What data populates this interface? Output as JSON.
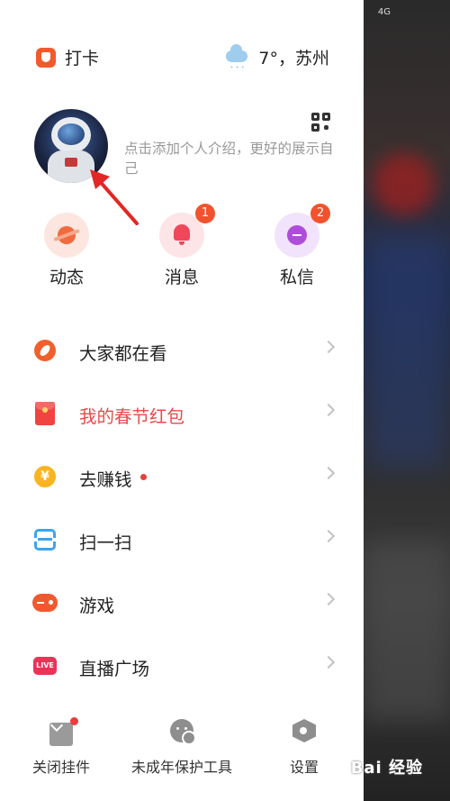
{
  "status_bar": {
    "signal_text": "4G"
  },
  "topbar": {
    "checkin_label": "打卡",
    "weather_label": "7°，苏州"
  },
  "profile": {
    "intro_placeholder": "点击添加个人介绍，更好的展示自己"
  },
  "quick_actions": [
    {
      "label": "动态",
      "icon": "planet-icon",
      "badge": ""
    },
    {
      "label": "消息",
      "icon": "bell-icon",
      "badge": "1"
    },
    {
      "label": "私信",
      "icon": "chat-bubble-icon",
      "badge": "2"
    }
  ],
  "menu": [
    {
      "label": "大家都在看",
      "icon": "compass-icon"
    },
    {
      "label": "我的春节红包",
      "icon": "red-packet-icon"
    },
    {
      "label": "去赚钱",
      "icon": "coin-icon",
      "coin_symbol": "¥"
    },
    {
      "label": "扫一扫",
      "icon": "scan-icon"
    },
    {
      "label": "游戏",
      "icon": "gamepad-icon"
    },
    {
      "label": "直播广场",
      "icon": "live-icon",
      "live_text": "LIVE"
    }
  ],
  "bottom_bar": [
    {
      "label": "关闭挂件",
      "icon": "mail-icon"
    },
    {
      "label": "未成年保护工具",
      "icon": "minor-protection-icon"
    },
    {
      "label": "设置",
      "icon": "settings-hex-icon"
    }
  ],
  "watermark": "Bai 经验",
  "colors": {
    "accent_orange": "#f2522e",
    "highlight_red": "#e64a4a",
    "arrow_red": "#e32626"
  }
}
